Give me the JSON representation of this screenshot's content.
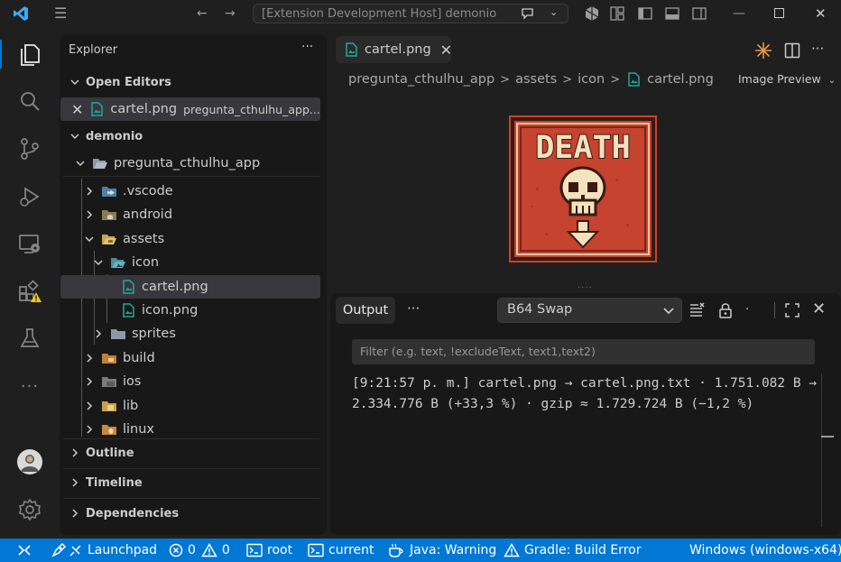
{
  "titlebar": {
    "title": "[Extension Development Host] demonio"
  },
  "sidebar": {
    "title": "Explorer",
    "open_editors_label": "Open Editors",
    "open_editor_file": "cartel.png",
    "open_editor_path": "pregunta_cthulhu_app...",
    "workspace_label": "demonio",
    "tree": {
      "root": "pregunta_cthulhu_app",
      "vscode": ".vscode",
      "android": "android",
      "assets": "assets",
      "icon": "icon",
      "cartel": "cartel.png",
      "iconpng": "icon.png",
      "sprites": "sprites",
      "build": "build",
      "ios": "ios",
      "lib": "lib",
      "linux": "linux"
    },
    "outline_label": "Outline",
    "timeline_label": "Timeline",
    "dependencies_label": "Dependencies"
  },
  "editor": {
    "tab_label": "cartel.png",
    "breadcrumb": [
      "pregunta_cthulhu_app",
      "assets",
      "icon",
      "cartel.png"
    ],
    "preview_mode": "Image Preview",
    "image_text": "DEATH"
  },
  "panel": {
    "tab_label": "Output",
    "channel": "B64 Swap",
    "filter_placeholder": "Filter (e.g. text, !excludeText, text1,text2)",
    "log_line": "[9:21:57 p. m.] cartel.png → cartel.png.txt · 1.751.082 B → 2.334.776 B (+33,3 %) · gzip ≈ 1.729.724 B (−1,2 %)"
  },
  "statusbar": {
    "launchpad": "Launchpad",
    "errors": "0",
    "warnings": "0",
    "root": "root",
    "current": "current",
    "java": "Java: Warning",
    "gradle": "Gradle: Build Error",
    "platform": "Windows (windows-x64)"
  },
  "colors": {
    "accent": "#0078d4",
    "background": "#1f1f1f",
    "sidebar": "#181818",
    "selection": "#37373d",
    "poster_red": "#c5432f",
    "poster_cream": "#f2e2bd"
  }
}
